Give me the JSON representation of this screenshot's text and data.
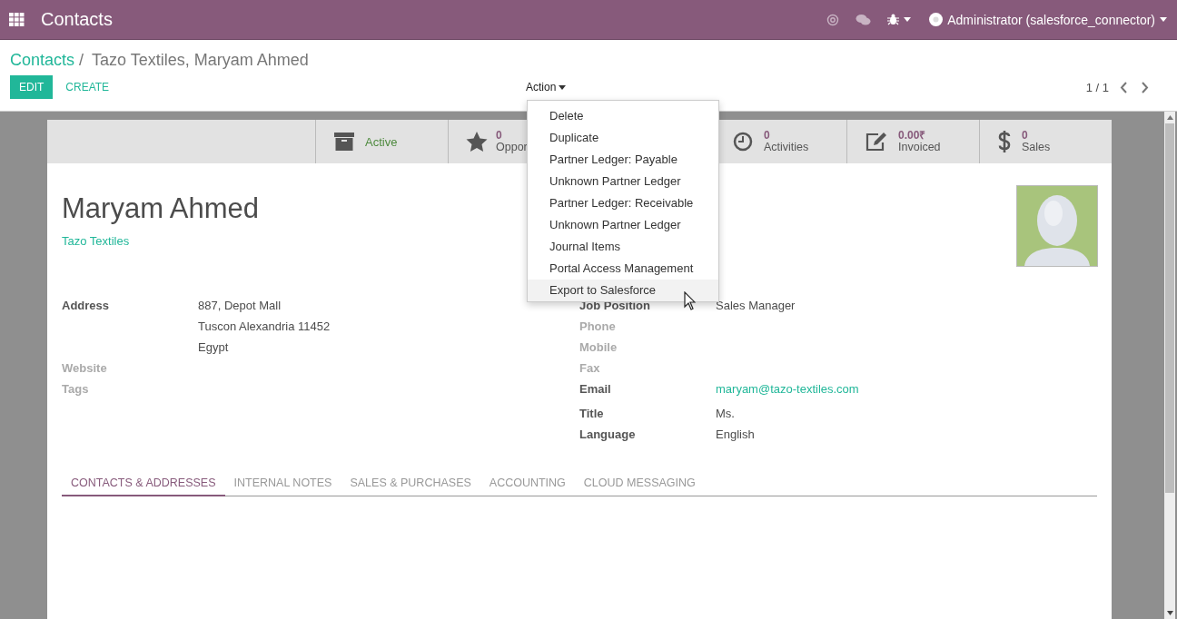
{
  "navbar": {
    "app_title": "Contacts",
    "user": "Administrator (salesforce_connector)"
  },
  "breadcrumb": [
    {
      "label": "Contacts",
      "kind": "link",
      "separator": "/"
    },
    {
      "label": "Tazo Textiles, Maryam Ahmed",
      "kind": "current"
    }
  ],
  "buttons": [
    {
      "label": "EDIT",
      "kind": "primary"
    },
    {
      "label": "CREATE",
      "kind": "link"
    }
  ],
  "action": {
    "label": "Action",
    "expanded": true,
    "items": [
      {
        "label": "Delete",
        "selected": false
      },
      {
        "label": "Duplicate",
        "selected": false
      },
      {
        "label": "Partner Ledger: Payable",
        "selected": false
      },
      {
        "label": "Unknown Partner Ledger",
        "selected": false
      },
      {
        "label": "Partner Ledger: Receivable",
        "selected": false
      },
      {
        "label": "Unknown Partner Ledger",
        "selected": false
      },
      {
        "label": "Journal Items",
        "selected": false
      },
      {
        "label": "Portal Access Management",
        "selected": false
      },
      {
        "label": "Export to Salesforce",
        "selected": true
      }
    ]
  },
  "pager": "1 / 1",
  "stat_buttons": [
    {
      "kind": "archive",
      "label": "Active"
    },
    {
      "kind": "star",
      "value": "0",
      "label": "Oppor"
    },
    {
      "kind": "clock",
      "value": "0",
      "label": "Activities"
    },
    {
      "kind": "edit",
      "value": "0.00₹",
      "label": "Invoiced"
    },
    {
      "kind": "dollar",
      "value": "0",
      "label": "Sales"
    }
  ],
  "contact": {
    "name": "Maryam Ahmed",
    "company": "Tazo Textiles"
  },
  "left_fields": [
    {
      "label": "Address",
      "lines": [
        "887, Depot Mall",
        "Tuscon  Alexandria  11452",
        "Egypt"
      ]
    },
    {
      "label": "Website"
    },
    {
      "label": "Tags"
    }
  ],
  "right_fields": [
    {
      "label": "Job Position",
      "value": "Sales Manager",
      "kind": "text"
    },
    {
      "label": "Phone"
    },
    {
      "label": "Mobile"
    },
    {
      "label": "Fax"
    },
    {
      "label": "Email",
      "value": "maryam@tazo-textiles.com",
      "kind": "link"
    },
    {
      "label": "Title",
      "value": "Ms.",
      "kind": "text"
    },
    {
      "label": "Language",
      "value": "English",
      "kind": "text"
    }
  ],
  "tabs": [
    {
      "label": "CONTACTS & ADDRESSES",
      "selected": true
    },
    {
      "label": "INTERNAL NOTES",
      "selected": false
    },
    {
      "label": "SALES & PURCHASES",
      "selected": false
    },
    {
      "label": "ACCOUNTING",
      "selected": false
    },
    {
      "label": "CLOUD MESSAGING",
      "selected": false
    }
  ]
}
